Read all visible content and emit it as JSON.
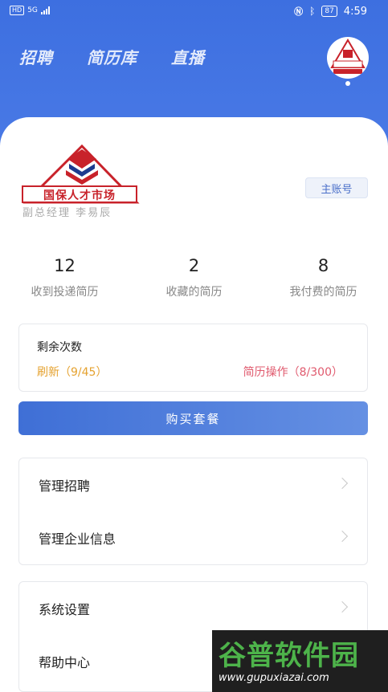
{
  "status_bar": {
    "network": "HD",
    "signal_label": "5G",
    "battery": "87",
    "time": "4:59"
  },
  "top_nav": {
    "tabs": [
      "招聘",
      "简历库",
      "直播"
    ]
  },
  "company": {
    "logo_text": "国保人才市场",
    "faint_name": "副总经理 李易辰",
    "account_badge": "主账号"
  },
  "stats": [
    {
      "value": "12",
      "label": "收到投递简历"
    },
    {
      "value": "2",
      "label": "收藏的简历"
    },
    {
      "value": "8",
      "label": "我付费的简历"
    }
  ],
  "remaining": {
    "title": "剩余次数",
    "refresh": "刷新（9/45）",
    "resume_ops": "简历操作（8/300）"
  },
  "buy_button": "购买套餐",
  "menu_group_1": [
    "管理招聘",
    "管理企业信息"
  ],
  "menu_group_2": [
    "系统设置",
    "帮助中心"
  ],
  "watermark": {
    "brand": "谷普软件园",
    "url": "www.gupuxiazai.com"
  },
  "colors": {
    "header": "#3d6fe0",
    "refresh": "#e5a22f",
    "resume_ops": "#e05a6e",
    "badge_text": "#4a6fc9",
    "logo_red": "#c8222a"
  }
}
